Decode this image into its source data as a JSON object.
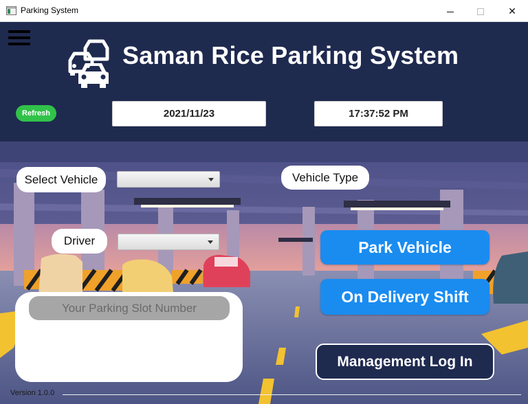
{
  "window": {
    "title": "Parking System",
    "controls": [
      "minimize",
      "maximize",
      "close"
    ],
    "close_glyph": "✕"
  },
  "header": {
    "app_name": "Saman Rice Parking System",
    "logo_icon": "cars-traffic-icon",
    "menu_icon": "hamburger-menu-icon",
    "refresh_label": "Refresh",
    "date": "2021/11/23",
    "time": "17:37:52 PM",
    "background_color": "#1f2a4f",
    "refresh_color": "#31c24a"
  },
  "form": {
    "select_vehicle_label": "Select Vehicle",
    "select_vehicle_value": "",
    "vehicle_type_label": "Vehicle Type",
    "driver_label": "Driver",
    "driver_value": ""
  },
  "actions": {
    "park_vehicle": "Park Vehicle",
    "on_delivery_shift": "On Delivery Shift",
    "management_login": "Management Log In",
    "primary_color": "#1a8cf0"
  },
  "slot": {
    "placeholder": "Your Parking Slot Number"
  },
  "footer": {
    "version": "Version 1.0.0"
  }
}
